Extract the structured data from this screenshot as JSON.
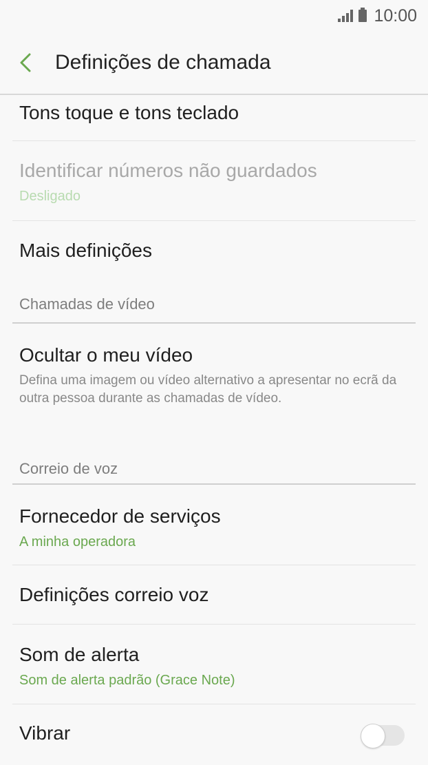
{
  "status_bar": {
    "time": "10:00"
  },
  "header": {
    "title": "Definições de chamada"
  },
  "items": {
    "tons": {
      "label": "Tons toque e tons teclado"
    },
    "identificar": {
      "label": "Identificar números não guardados",
      "value": "Desligado",
      "enabled": false
    },
    "mais": {
      "label": "Mais definições"
    },
    "ocultar": {
      "label": "Ocultar o meu vídeo",
      "description": "Defina uma imagem ou vídeo alternativo a apresentar no ecrã da outra pessoa durante as chamadas de vídeo."
    },
    "fornecedor": {
      "label": "Fornecedor de serviços",
      "value": "A minha operadora"
    },
    "correio": {
      "label": "Definições correio voz"
    },
    "som": {
      "label": "Som de alerta",
      "value": "Som de alerta padrão (Grace Note)"
    },
    "vibrar": {
      "label": "Vibrar",
      "on": false
    }
  },
  "sections": {
    "video": "Chamadas de vídeo",
    "voz": "Correio de voz"
  },
  "colors": {
    "accent": "#6aa84f",
    "background": "#f8f8f8"
  },
  "icons": {
    "back": "back-chevron-icon"
  }
}
